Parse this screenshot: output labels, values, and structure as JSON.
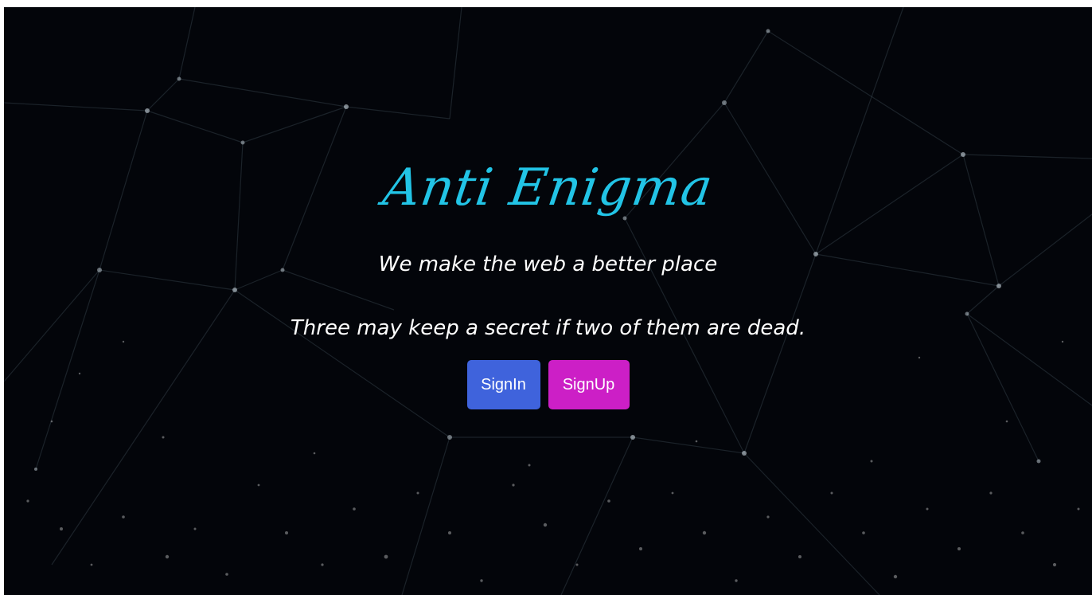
{
  "hero": {
    "brand": "Anti Enigma",
    "tagline": "We make the web a better place",
    "quote": "Three may keep a secret if two of them are dead."
  },
  "actions": {
    "signin_label": "SignIn",
    "signup_label": "SignUp"
  },
  "colors": {
    "background": "#03050a",
    "brand": "#22c4e6",
    "signin": "#3f63dc",
    "signup": "#cc1fc6",
    "text": "#ffffff"
  },
  "background_image": "network-constellation-particles"
}
